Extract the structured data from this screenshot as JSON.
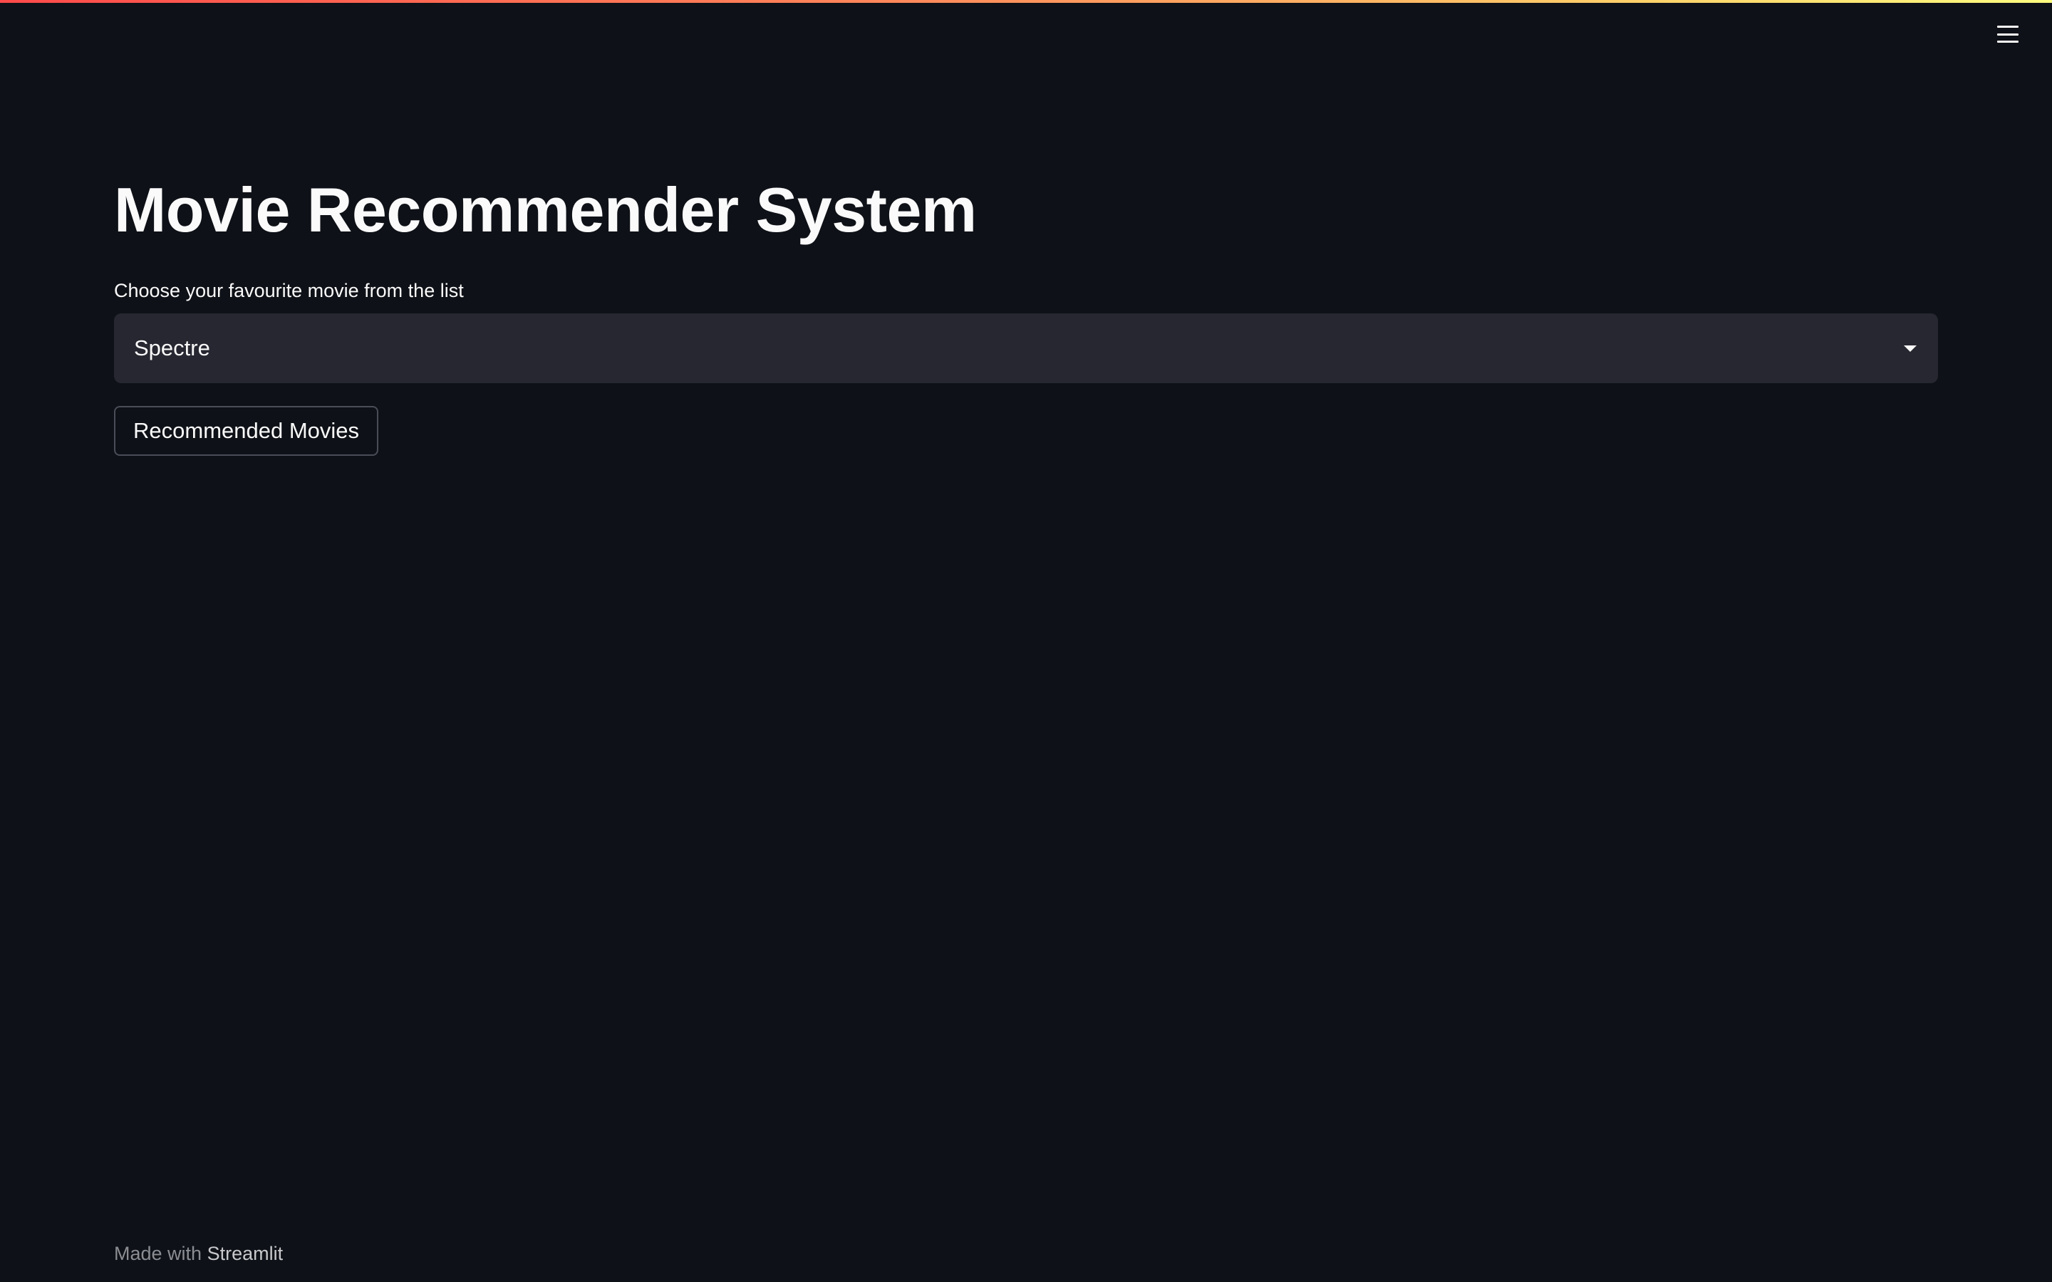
{
  "app": {
    "title": "Movie Recommender System",
    "accent_gradient": [
      "#ff4b4b",
      "#fffd80"
    ],
    "background": "#0e1117"
  },
  "header": {
    "menu_icon": "hamburger-menu-icon"
  },
  "selector": {
    "label": "Choose your favourite movie from the list",
    "selected_value": "Spectre",
    "icon": "chevron-down-icon"
  },
  "action": {
    "button_label": "Recommended Movies"
  },
  "footer": {
    "prefix": "Made with",
    "brand": "Streamlit"
  }
}
